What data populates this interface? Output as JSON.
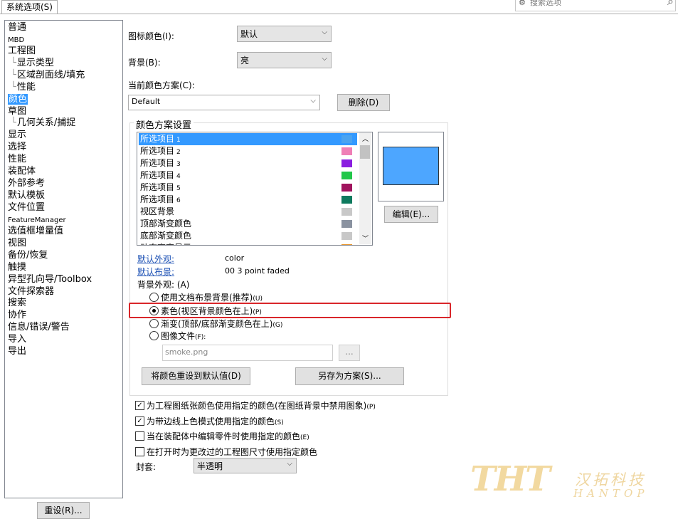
{
  "tab": {
    "label": "系统选项(S)"
  },
  "search": {
    "placeholder": "搜索选项"
  },
  "sidebar": {
    "items": [
      {
        "label": "普通"
      },
      {
        "label": "MBD"
      },
      {
        "label": "工程图"
      },
      {
        "label": "显示类型"
      },
      {
        "label": "区域剖面线/填充"
      },
      {
        "label": "性能"
      },
      {
        "label": "颜色"
      },
      {
        "label": "草图"
      },
      {
        "label": "几何关系/捕捉"
      },
      {
        "label": "显示"
      },
      {
        "label": "选择"
      },
      {
        "label": "性能"
      },
      {
        "label": "装配体"
      },
      {
        "label": "外部参考"
      },
      {
        "label": "默认模板"
      },
      {
        "label": "文件位置"
      },
      {
        "label": "FeatureManager"
      },
      {
        "label": "选值框增量值"
      },
      {
        "label": "视图"
      },
      {
        "label": "备份/恢复"
      },
      {
        "label": "触摸"
      },
      {
        "label": "异型孔向导/Toolbox"
      },
      {
        "label": "文件探索器"
      },
      {
        "label": "搜索"
      },
      {
        "label": "协作"
      },
      {
        "label": "信息/错误/警告"
      },
      {
        "label": "导入"
      },
      {
        "label": "导出"
      }
    ],
    "selected": "颜色"
  },
  "reset_button": {
    "label": "重设(R)..."
  },
  "icon_color": {
    "label": "图标颜色(I):",
    "value": "默认"
  },
  "background": {
    "label": "背景(B):",
    "value": "亮"
  },
  "scheme": {
    "label": "当前颜色方案(C):",
    "value": "Default",
    "delete_label": "删除(D)"
  },
  "settings": {
    "title": "颜色方案设置",
    "items": [
      {
        "label": "所选项目",
        "num": "1",
        "color": "#4aa3f0"
      },
      {
        "label": "所选项目",
        "num": "2",
        "color": "#ef7fb6"
      },
      {
        "label": "所选项目",
        "num": "3",
        "color": "#8a1ee0"
      },
      {
        "label": "所选项目",
        "num": "4",
        "color": "#22c74a"
      },
      {
        "label": "所选项目",
        "num": "5",
        "color": "#a0145e"
      },
      {
        "label": "所选项目",
        "num": "6",
        "color": "#0e7a5e"
      },
      {
        "label": "视区背景",
        "num": "",
        "color": "#c8c8c8"
      },
      {
        "label": "顶部渐变颜色",
        "num": "",
        "color": "#8a92a0"
      },
      {
        "label": "底部渐变颜色",
        "num": "",
        "color": "#c8c8c8"
      },
      {
        "label": "动态高亮显示",
        "num": "",
        "color": "#e8962e"
      }
    ],
    "preview_color": "#4da6ff",
    "edit_label": "编辑(E)...",
    "default_appearance": {
      "label": "默认外观:",
      "value": "color"
    },
    "default_scene": {
      "label": "默认布景:",
      "value": "00 3 point faded"
    },
    "bg_appearance_label": "背景外观: (A)",
    "radios": [
      {
        "label": "使用文档布景背景(推荐)",
        "key": "(U)",
        "checked": false
      },
      {
        "label": "素色(视区背景颜色在上)",
        "key": "(P)",
        "checked": true
      },
      {
        "label": "渐变(顶部/底部渐变颜色在上)",
        "key": "(G)",
        "checked": false
      },
      {
        "label": "图像文件",
        "key": "(F):",
        "checked": false
      }
    ],
    "image_file": "smoke.png",
    "browse_label": "...",
    "reset_colors_label": "将颜色重设到默认值(D)",
    "save_scheme_label": "另存为方案(S)..."
  },
  "checkboxes": [
    {
      "label": "为工程图纸张颜色使用指定的颜色(在图纸背景中禁用图象)",
      "key": "(P)",
      "checked": true
    },
    {
      "label": "为带边线上色模式使用指定的颜色",
      "key": "(S)",
      "checked": true
    },
    {
      "label": "当在装配体中编辑零件时使用指定的颜色",
      "key": "(E)",
      "checked": false
    },
    {
      "label": "在打开时为更改过的工程图尺寸使用指定颜色",
      "key": "",
      "checked": false
    }
  ],
  "envelope": {
    "label": "封套:",
    "value": "半透明"
  },
  "highlight_color": "#d9262a",
  "watermark": {
    "logo": "THT",
    "cn": "汉拓科技",
    "en": "HANTOP"
  }
}
